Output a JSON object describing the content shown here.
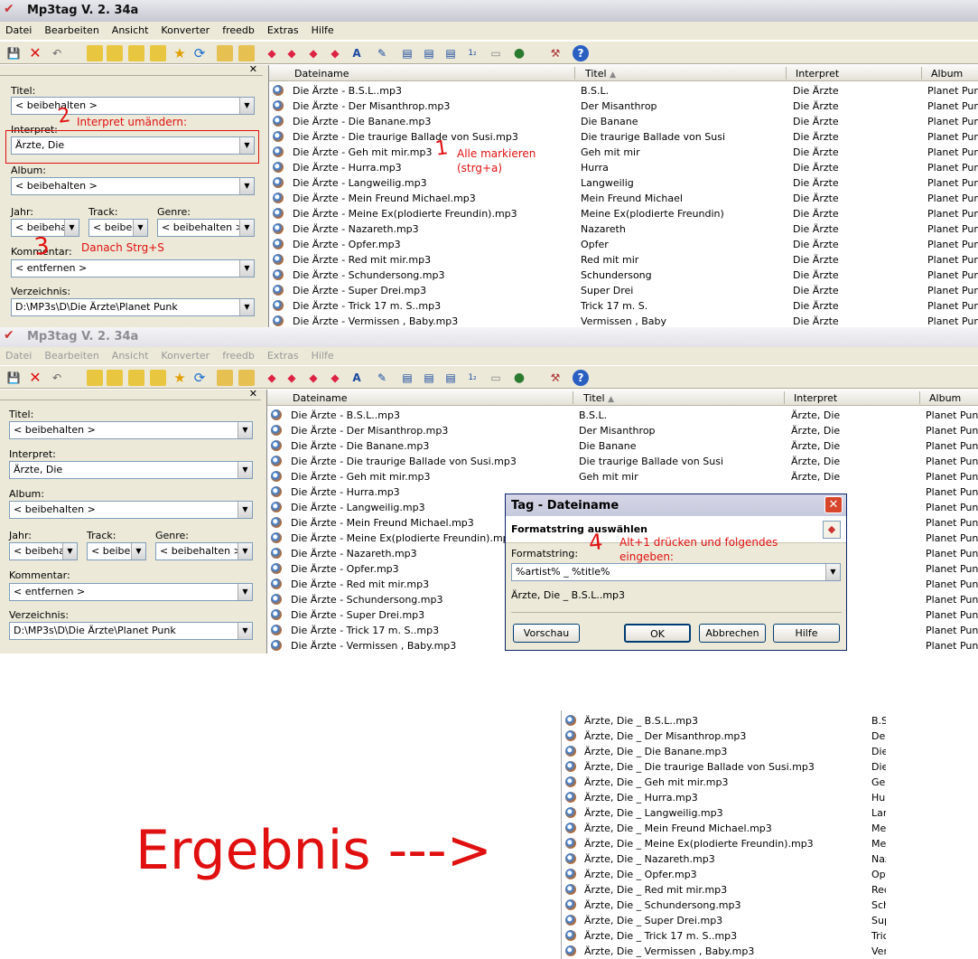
{
  "window1": {
    "title": "Mp3tag V. 2. 34a",
    "menu": [
      "Datei",
      "Bearbeiten",
      "Ansicht",
      "Konverter",
      "freedb",
      "Extras",
      "Hilfe"
    ],
    "fields": {
      "titel_label": "Titel:",
      "titel_value": "< beibehalten >",
      "interpret_label": "Interpret:",
      "interpret_value": "Ärzte, Die",
      "album_label": "Album:",
      "album_value": "< beibehalten >",
      "jahr_label": "Jahr:",
      "jahr_value": "< beibeha",
      "track_label": "Track:",
      "track_value": "< beibel",
      "genre_label": "Genre:",
      "genre_value": "< beibehalten >",
      "kommentar_label": "Kommentar:",
      "kommentar_value": "< entfernen >",
      "verzeichnis_label": "Verzeichnis:",
      "verzeichnis_value": "D:\\MP3s\\D\\Die Ärzte\\Planet Punk"
    },
    "columns": {
      "dateiname": "Dateiname",
      "titel": "Titel",
      "interpret": "Interpret",
      "album": "Album"
    },
    "rows": [
      [
        "Die Ärzte - B.S.L..mp3",
        "B.S.L.",
        "Die Ärzte",
        "Planet Punk"
      ],
      [
        "Die Ärzte - Der Misanthrop.mp3",
        "Der Misanthrop",
        "Die Ärzte",
        "Planet Punk"
      ],
      [
        "Die Ärzte - Die Banane.mp3",
        "Die Banane",
        "Die Ärzte",
        "Planet Punk"
      ],
      [
        "Die Ärzte - Die traurige Ballade von Susi.mp3",
        "Die traurige Ballade von Susi",
        "Die Ärzte",
        "Planet Punk"
      ],
      [
        "Die Ärzte - Geh mit mir.mp3",
        "Geh mit mir",
        "Die Ärzte",
        "Planet Punk"
      ],
      [
        "Die Ärzte - Hurra.mp3",
        "Hurra",
        "Die Ärzte",
        "Planet Punk"
      ],
      [
        "Die Ärzte - Langweilig.mp3",
        "Langweilig",
        "Die Ärzte",
        "Planet Punk"
      ],
      [
        "Die Ärzte - Mein Freund Michael.mp3",
        "Mein Freund Michael",
        "Die Ärzte",
        "Planet Punk"
      ],
      [
        "Die Ärzte - Meine Ex(plodierte Freundin).mp3",
        "Meine Ex(plodierte Freundin)",
        "Die Ärzte",
        "Planet Punk"
      ],
      [
        "Die Ärzte - Nazareth.mp3",
        "Nazareth",
        "Die Ärzte",
        "Planet Punk"
      ],
      [
        "Die Ärzte - Opfer.mp3",
        "Opfer",
        "Die Ärzte",
        "Planet Punk"
      ],
      [
        "Die Ärzte - Red mit mir.mp3",
        "Red mit mir",
        "Die Ärzte",
        "Planet Punk"
      ],
      [
        "Die Ärzte - Schundersong.mp3",
        "Schundersong",
        "Die Ärzte",
        "Planet Punk"
      ],
      [
        "Die Ärzte - Super Drei.mp3",
        "Super Drei",
        "Die Ärzte",
        "Planet Punk"
      ],
      [
        "Die Ärzte - Trick 17 m. S..mp3",
        "Trick 17 m. S.",
        "Die Ärzte",
        "Planet Punk"
      ],
      [
        "Die Ärzte - Vermissen , Baby.mp3",
        "Vermissen , Baby",
        "Die Ärzte",
        "Planet Punk"
      ]
    ]
  },
  "annotations": {
    "step1_num": "1",
    "step1_text": "Alle markieren",
    "step1_text2": "(strg+a)",
    "step2_num": "2",
    "step2_text": "Interpret umändern:",
    "step3_num": "3",
    "step3_text": "Danach Strg+S",
    "step4_num": "4",
    "step4_text": "Alt+1 drücken und folgendes",
    "step4_text2": "eingeben:",
    "result": "Ergebnis --->"
  },
  "window2": {
    "title": "Mp3tag V. 2. 34a",
    "rows": [
      [
        "Die Ärzte - B.S.L..mp3",
        "B.S.L.",
        "Ärzte, Die",
        "Planet Punk"
      ],
      [
        "Die Ärzte - Der Misanthrop.mp3",
        "Der Misanthrop",
        "Ärzte, Die",
        "Planet Punk"
      ],
      [
        "Die Ärzte - Die Banane.mp3",
        "Die Banane",
        "Ärzte, Die",
        "Planet Punk"
      ],
      [
        "Die Ärzte - Die traurige Ballade von Susi.mp3",
        "Die traurige Ballade von Susi",
        "Ärzte, Die",
        "Planet Punk"
      ],
      [
        "Die Ärzte - Geh mit mir.mp3",
        "Geh mit mir",
        "Ärzte, Die",
        "Planet Punk"
      ],
      [
        "Die Ärzte - Hurra.mp3",
        "",
        "",
        "Planet Punk"
      ],
      [
        "Die Ärzte - Langweilig.mp3",
        "",
        "",
        "Planet Punk"
      ],
      [
        "Die Ärzte - Mein Freund Michael.mp3",
        "",
        "",
        "Planet Punk"
      ],
      [
        "Die Ärzte - Meine Ex(plodierte Freundin).mp3",
        "",
        "",
        "Planet Punk"
      ],
      [
        "Die Ärzte - Nazareth.mp3",
        "",
        "",
        "Planet Punk"
      ],
      [
        "Die Ärzte - Opfer.mp3",
        "",
        "",
        "Planet Punk"
      ],
      [
        "Die Ärzte - Red mit mir.mp3",
        "",
        "",
        "Planet Punk"
      ],
      [
        "Die Ärzte - Schundersong.mp3",
        "",
        "",
        "Planet Punk"
      ],
      [
        "Die Ärzte - Super Drei.mp3",
        "",
        "",
        "Planet Punk"
      ],
      [
        "Die Ärzte - Trick 17 m. S..mp3",
        "",
        "",
        "Planet Punk"
      ],
      [
        "Die Ärzte - Vermissen , Baby.mp3",
        "",
        "",
        "Planet Punk"
      ]
    ],
    "dialog": {
      "title": "Tag  -  Dateiname",
      "subtitle": "Formatstring auswählen",
      "format_label": "Formatstring:",
      "format_value": "%artist% _ %title%",
      "preview": "Ärzte, Die _ B.S.L..mp3",
      "btn_preview": "Vorschau",
      "btn_ok": "OK",
      "btn_cancel": "Abbrechen",
      "btn_help": "Hilfe"
    }
  },
  "result_rows": [
    [
      "Ärzte, Die _ B.S.L..mp3",
      "B.S"
    ],
    [
      "Ärzte, Die _ Der Misanthrop.mp3",
      "Der"
    ],
    [
      "Ärzte, Die _ Die Banane.mp3",
      "Die"
    ],
    [
      "Ärzte, Die _ Die traurige Ballade von Susi.mp3",
      "Die"
    ],
    [
      "Ärzte, Die _ Geh mit mir.mp3",
      "Geh"
    ],
    [
      "Ärzte, Die _ Hurra.mp3",
      "Hur"
    ],
    [
      "Ärzte, Die _ Langweilig.mp3",
      "Lan"
    ],
    [
      "Ärzte, Die _ Mein Freund Michael.mp3",
      "Mei"
    ],
    [
      "Ärzte, Die _ Meine Ex(plodierte Freundin).mp3",
      "Mei"
    ],
    [
      "Ärzte, Die _ Nazareth.mp3",
      "Naz"
    ],
    [
      "Ärzte, Die _ Opfer.mp3",
      "Opf"
    ],
    [
      "Ärzte, Die _ Red mit mir.mp3",
      "Rec"
    ],
    [
      "Ärzte, Die _ Schundersong.mp3",
      "Sch"
    ],
    [
      "Ärzte, Die _ Super Drei.mp3",
      "Sup"
    ],
    [
      "Ärzte, Die _ Trick 17 m. S..mp3",
      "Tric"
    ],
    [
      "Ärzte, Die _ Vermissen , Baby.mp3",
      "Ver"
    ]
  ]
}
